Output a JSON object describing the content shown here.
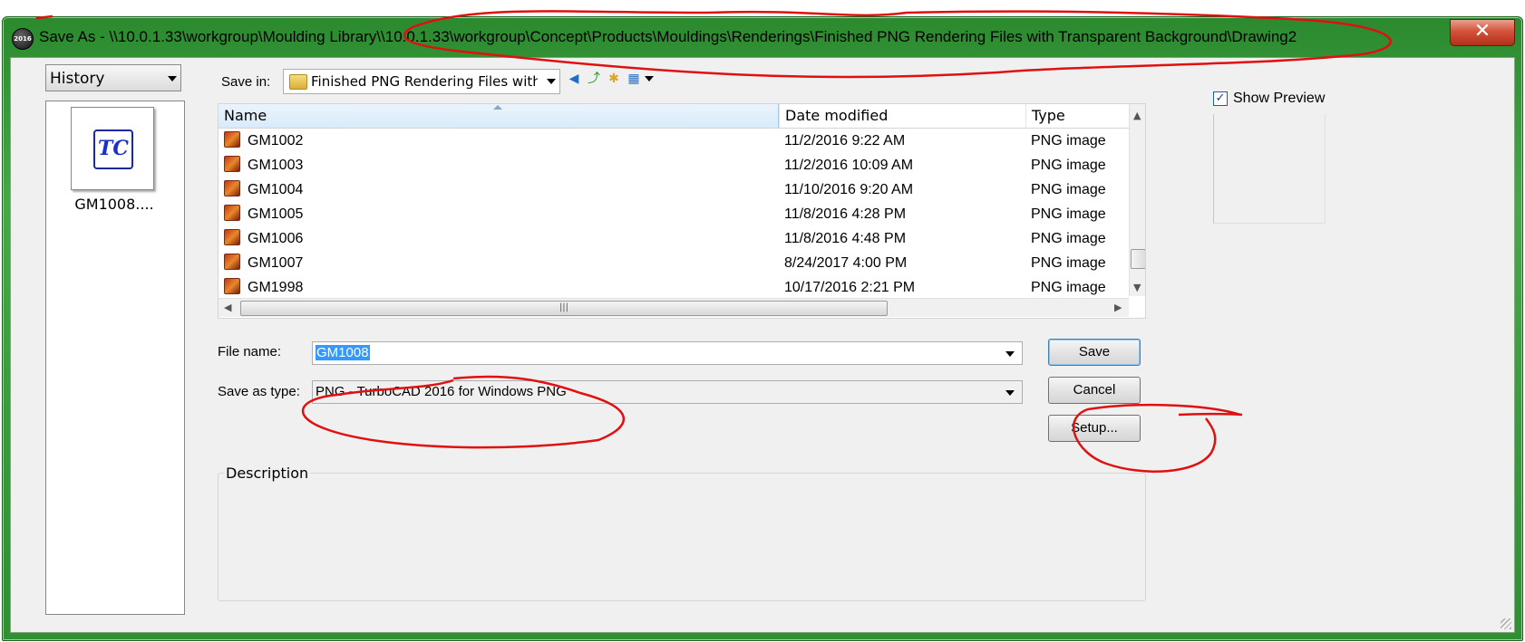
{
  "window": {
    "app_icon_text": "2016",
    "title": "Save As - \\\\10.0.1.33\\workgroup\\Moulding Library\\\\10.0.1.33\\workgroup\\Concept\\Products\\Mouldings\\Renderings\\Finished PNG Rendering Files with Transparent Background\\Drawing2",
    "close_glyph": "✕"
  },
  "left_panel": {
    "history_label": "History",
    "thumbnail_logo": "TC",
    "thumbnail_label": "GM1008...."
  },
  "save_in": {
    "label": "Save in:",
    "folder": "Finished PNG Rendering Files with Transparent Background"
  },
  "toolbar_icons": [
    "back-icon",
    "up-folder-icon",
    "new-folder-icon",
    "view-menu-icon"
  ],
  "file_list": {
    "columns": [
      "Name",
      "Date modified",
      "Type"
    ],
    "rows": [
      {
        "name": "GM1002",
        "date": "11/2/2016 9:22 AM",
        "type": "PNG image"
      },
      {
        "name": "GM1003",
        "date": "11/2/2016 10:09 AM",
        "type": "PNG image"
      },
      {
        "name": "GM1004",
        "date": "11/10/2016 9:20 AM",
        "type": "PNG image"
      },
      {
        "name": "GM1005",
        "date": "11/8/2016 4:28 PM",
        "type": "PNG image"
      },
      {
        "name": "GM1006",
        "date": "11/8/2016 4:48 PM",
        "type": "PNG image"
      },
      {
        "name": "GM1007",
        "date": "8/24/2017 4:00 PM",
        "type": "PNG image"
      },
      {
        "name": "GM1998",
        "date": "10/17/2016 2:21 PM",
        "type": "PNG image"
      }
    ]
  },
  "form": {
    "file_name_label": "File name:",
    "file_name_value": "GM1008",
    "save_type_label": "Save as type:",
    "save_type_value": "PNG  - TurboCAD 2016 for Windows PNG"
  },
  "buttons": {
    "save": "Save",
    "cancel": "Cancel",
    "setup": "Setup..."
  },
  "description": {
    "label": "Description"
  },
  "preview": {
    "show_preview_label": "Show Preview",
    "checked": true
  },
  "colors": {
    "titlebar": "#3a9c3c",
    "annotation": "#e01010",
    "selection": "#3399ff"
  }
}
